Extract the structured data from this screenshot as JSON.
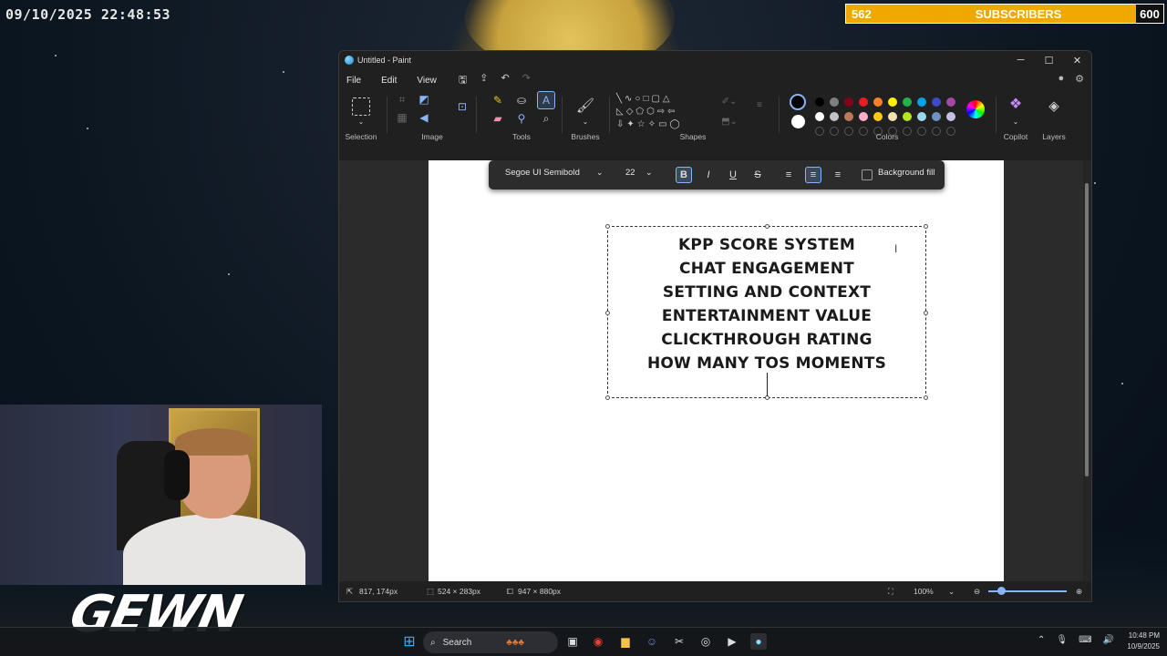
{
  "overlay": {
    "clock": "09/10/2025 22:48:53",
    "subs_current": "562",
    "subs_label": "SUBSCRIBERS",
    "subs_goal": "600",
    "logo": "GEWN"
  },
  "window": {
    "title": "Untitled - Paint",
    "menu": [
      "File",
      "Edit",
      "View"
    ]
  },
  "ribbon": {
    "groups": {
      "selection": "Selection",
      "image": "Image",
      "tools": "Tools",
      "brushes": "Brushes",
      "shapes": "Shapes",
      "colors": "Colors",
      "copilot": "Copilot",
      "layers": "Layers"
    },
    "colors": {
      "primary": "#000000",
      "secondary": "#ffffff",
      "row1": [
        "#000000",
        "#7f7f7f",
        "#880015",
        "#ed1c24",
        "#ff7f27",
        "#fff200",
        "#22b14c",
        "#00a2e8",
        "#3f48cc",
        "#a349a4"
      ],
      "row2": [
        "#ffffff",
        "#c3c3c3",
        "#b97a57",
        "#ffaec9",
        "#ffc90e",
        "#efe4b0",
        "#b5e61d",
        "#99d9ea",
        "#7092be",
        "#c8bfe7"
      ]
    }
  },
  "text_toolbar": {
    "font": "Segoe UI Semibold",
    "size": "22",
    "bold": "B",
    "italic": "I",
    "underline": "U",
    "strike": "S",
    "background_fill": "Background fill"
  },
  "canvas_text": {
    "lines": [
      "KPP SCORE SYSTEM",
      "CHAT ENGAGEMENT",
      "SETTING AND CONTEXT",
      "ENTERTAINMENT VALUE",
      "CLICKTHROUGH RATING",
      "HOW MANY TOS MOMENTS"
    ]
  },
  "status": {
    "cursor": "817, 174px",
    "selection": "524 × 283px",
    "canvas_size": "947 × 880px",
    "zoom": "100%"
  },
  "taskbar": {
    "search": "Search",
    "time": "10:48 PM",
    "date": "10/9/2025"
  }
}
